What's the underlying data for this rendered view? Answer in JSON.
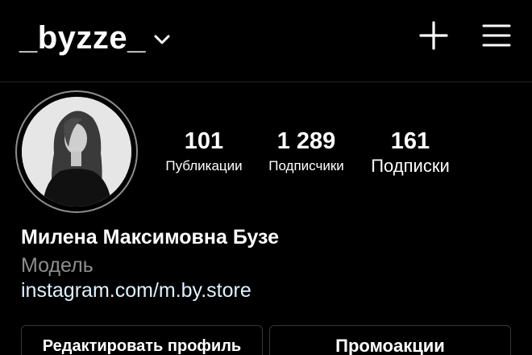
{
  "header": {
    "username": "_byzze_",
    "icons": {
      "switch_account": "chevron-down-icon",
      "create": "plus-icon",
      "menu": "hamburger-menu-icon"
    }
  },
  "profile": {
    "avatar_icon": "profile-photo",
    "stats": {
      "posts": {
        "value": "101",
        "label": "Публикации"
      },
      "followers": {
        "value": "1 289",
        "label": "Подписчики"
      },
      "following": {
        "value": "161",
        "label": "Подписки"
      }
    },
    "name": "Милена Максимовна Бузе",
    "category": "Модель",
    "link": "instagram.com/m.by.store"
  },
  "actions": {
    "edit_profile_label": "Редактировать профиль",
    "promotions_label": "Промоакции"
  },
  "colors": {
    "background": "#000000",
    "text": "#ffffff",
    "secondary_text": "#8e8e8e",
    "link": "#e0f1ff",
    "divider": "#262626",
    "button_border": "#363636"
  }
}
